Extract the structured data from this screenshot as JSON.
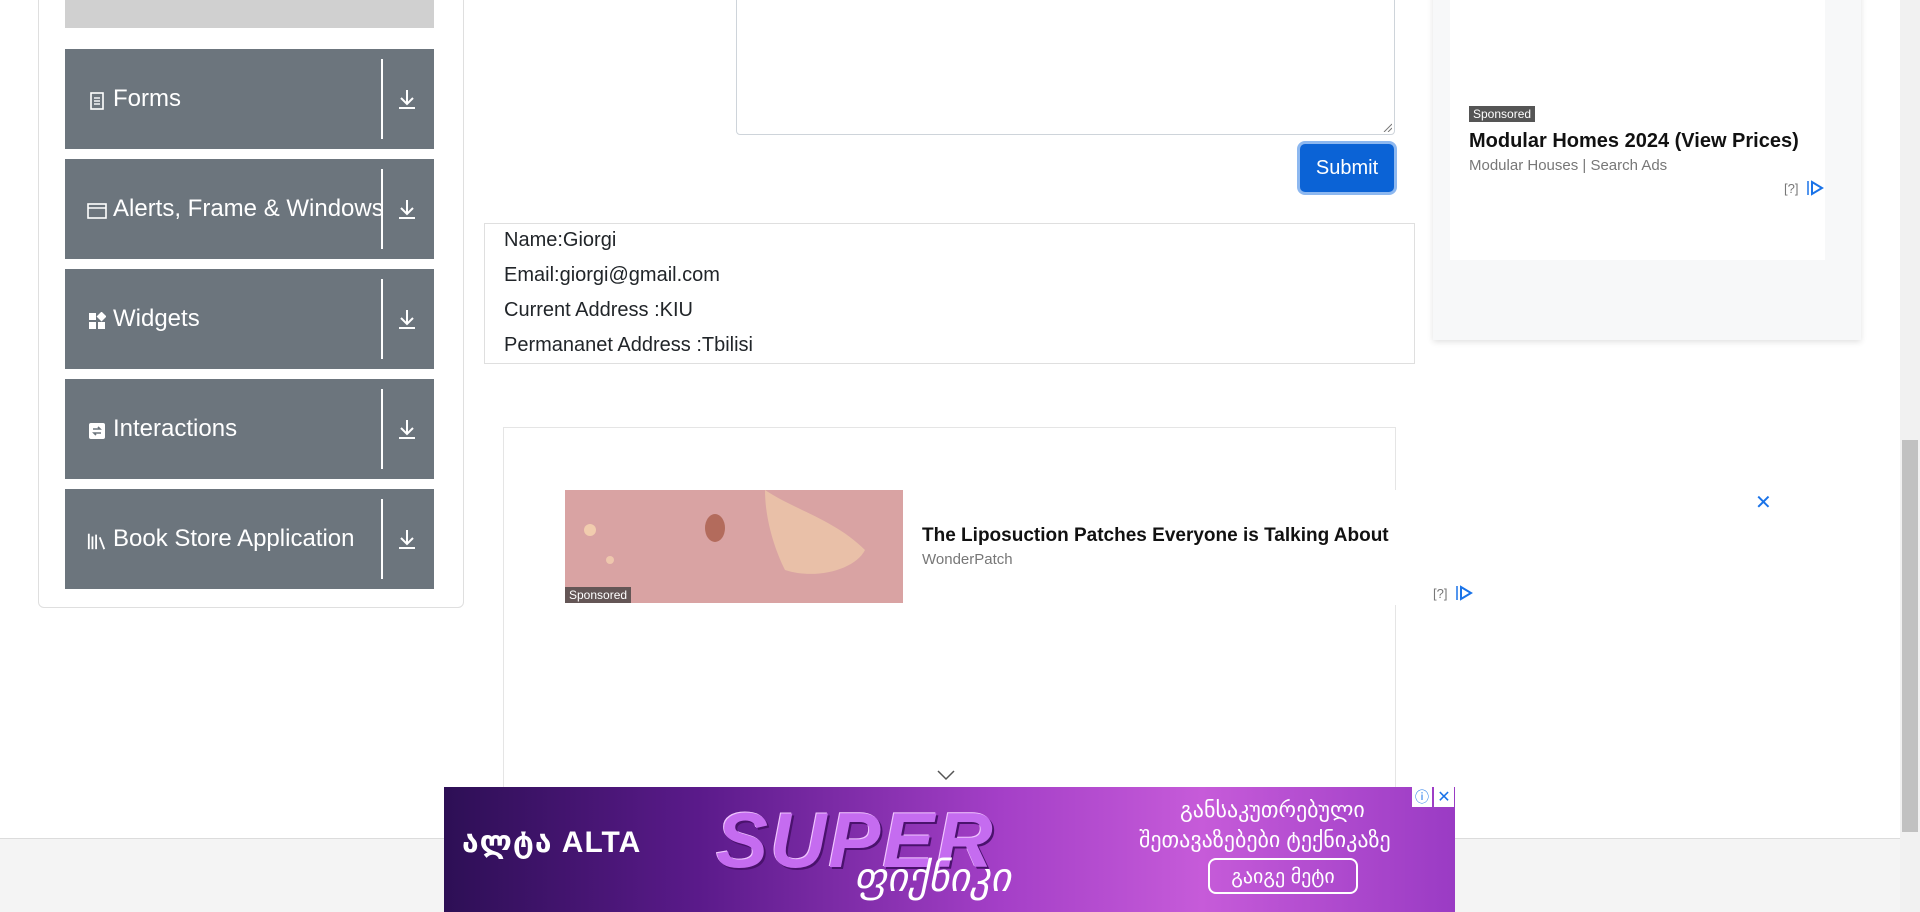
{
  "sidebar": {
    "groups": [
      {
        "label": "Forms",
        "icon": "forms-icon"
      },
      {
        "label": "Alerts, Frame & Windows",
        "icon": "window-icon"
      },
      {
        "label": "Widgets",
        "icon": "widgets-icon"
      },
      {
        "label": "Interactions",
        "icon": "interactions-icon"
      },
      {
        "label": "Book Store Application",
        "icon": "book-store-icon"
      }
    ]
  },
  "form": {
    "submit_label": "Submit"
  },
  "output": {
    "name": "Name:Giorgi",
    "email": "Email:giorgi@gmail.com",
    "current_address": "Current Address :KIU",
    "permanent_address": "Permananet Address :Tbilisi"
  },
  "right_ad": {
    "sponsored": "Sponsored",
    "title": "Modular Homes 2024 (View Prices)",
    "source": "Modular Houses | Search Ads",
    "help": "[?]"
  },
  "mid_ad": {
    "sponsored": "Sponsored",
    "title": "The Liposuction Patches Everyone is Talking About",
    "source": "WonderPatch",
    "help": "[?]",
    "close": "✕"
  },
  "bottom_banner": {
    "brand": "ალტა ALTA",
    "headline": "SUPER",
    "script": "ფიქნიკი",
    "line1": "განსაკუთრებული",
    "line2": "შეთავაზებები ტექნიკაზე",
    "cta": "გაიგე მეტი",
    "close": "✕",
    "info": "ⓘ"
  },
  "colors": {
    "sidebar_group_bg": "#6c757d",
    "submit_bg": "#0b63d6",
    "ad_accent": "#1a73e8"
  }
}
